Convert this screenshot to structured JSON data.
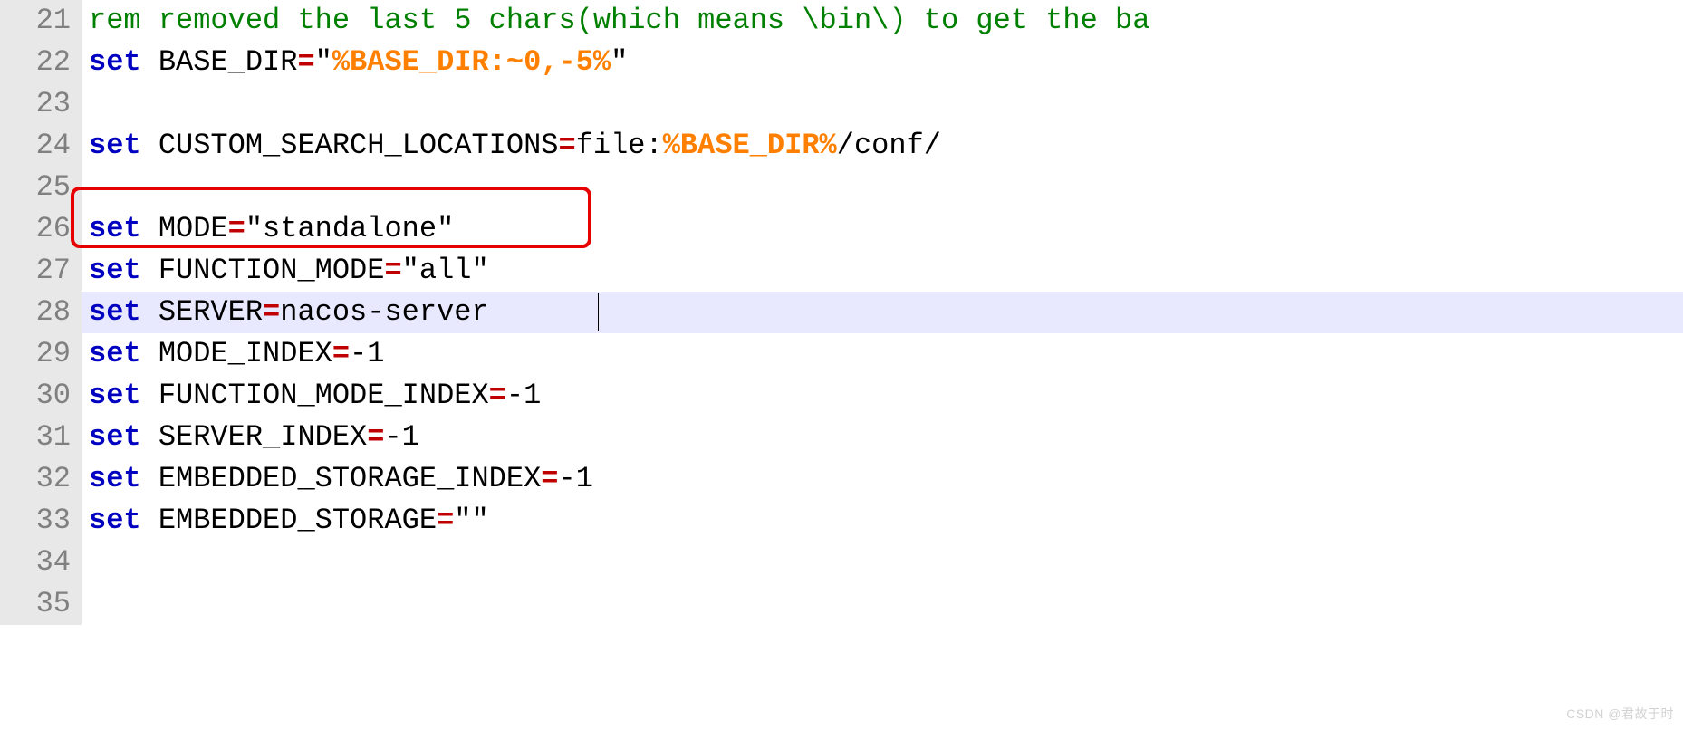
{
  "lines": {
    "21": {
      "num": "21",
      "comment": "rem removed the last 5 chars(which means \\bin\\) to get the ba"
    },
    "22": {
      "num": "22",
      "set": "set",
      "sp": " ",
      "lhs": "BASE_DIR",
      "eq": "=",
      "q1": "\"",
      "var": "%BASE_DIR:~0,-5%",
      "q2": "\""
    },
    "23": {
      "num": "23"
    },
    "24": {
      "num": "24",
      "set": "set",
      "sp": " ",
      "lhs": "CUSTOM_SEARCH_LOCATIONS",
      "eq": "=",
      "pre": "file:",
      "var": "%BASE_DIR%",
      "post": "/conf/"
    },
    "25": {
      "num": "25"
    },
    "26": {
      "num": "26",
      "set": "set",
      "sp": " ",
      "lhs": "MODE",
      "eq": "=",
      "rhs": "\"standalone\""
    },
    "27": {
      "num": "27",
      "set": "set",
      "sp": " ",
      "lhs": "FUNCTION_MODE",
      "eq": "=",
      "rhs": "\"all\""
    },
    "28": {
      "num": "28",
      "set": "set",
      "sp": " ",
      "lhs": "SERVER",
      "eq": "=",
      "rhs": "nacos-server"
    },
    "29": {
      "num": "29",
      "set": "set",
      "sp": " ",
      "lhs": "MODE_INDEX",
      "eq": "=",
      "rhs": "-1"
    },
    "30": {
      "num": "30",
      "set": "set",
      "sp": " ",
      "lhs": "FUNCTION_MODE_INDEX",
      "eq": "=",
      "rhs": "-1"
    },
    "31": {
      "num": "31",
      "set": "set",
      "sp": " ",
      "lhs": "SERVER_INDEX",
      "eq": "=",
      "rhs": "-1"
    },
    "32": {
      "num": "32",
      "set": "set",
      "sp": " ",
      "lhs": "EMBEDDED_STORAGE_INDEX",
      "eq": "=",
      "rhs": "-1"
    },
    "33": {
      "num": "33",
      "set": "set",
      "sp": " ",
      "lhs": "EMBEDDED_STORAGE",
      "eq": "=",
      "rhs": "\"\""
    },
    "34": {
      "num": "34"
    },
    "35": {
      "num": "35"
    }
  },
  "watermark": "CSDN @君故于时"
}
